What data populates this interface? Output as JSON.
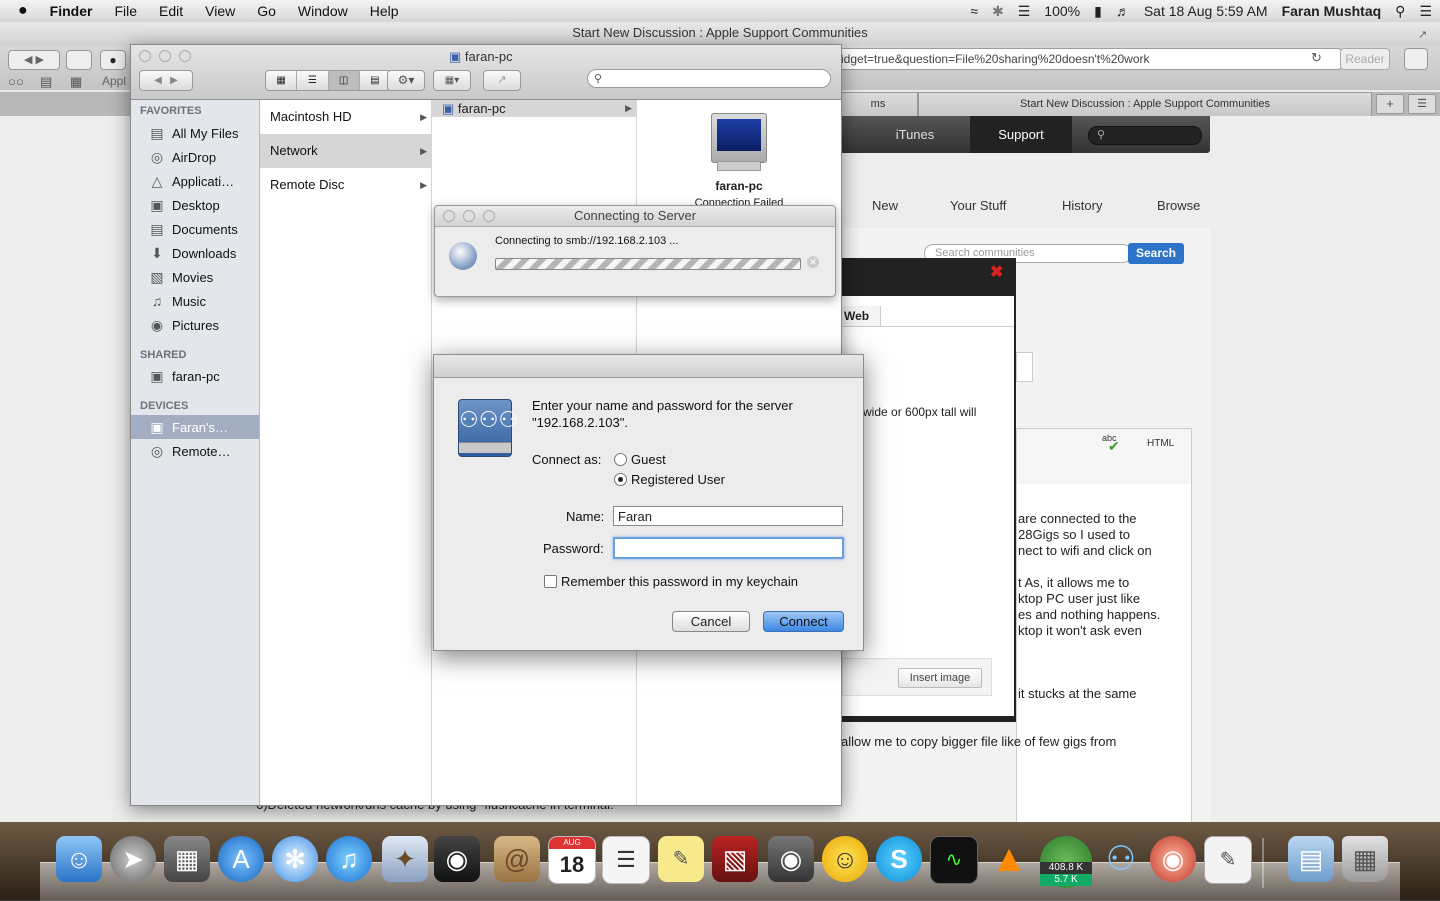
{
  "menubar": {
    "apple": "",
    "app": "Finder",
    "items": [
      "File",
      "Edit",
      "View",
      "Go",
      "Window",
      "Help"
    ],
    "battery": "100%",
    "datetime": "Sat 18 Aug  5:59 AM",
    "user": "Faran Mushtaq"
  },
  "safari": {
    "title": "Start New Discussion : Apple Support Communities",
    "address": "idget=true&question=File%20sharing%20doesn't%20work",
    "reader": "Reader",
    "bookmark_fragment": "Appl",
    "tab_left": "ms",
    "tab_right": "Start New Discussion : Apple Support Communities",
    "nav": {
      "itunes": "iTunes",
      "support": "Support"
    },
    "subnav": [
      "New",
      "Your Stuff",
      "History",
      "Browse"
    ],
    "search_placeholder": "Search communities",
    "search_button": "Search",
    "editor_tab": "Web",
    "html_label": "HTML",
    "spell_label": "abc",
    "insert_image": "Insert image",
    "body_lines": [
      "wide or 600px tall will",
      "are connected to the",
      "28Gigs so I used to",
      "nect to wifi and click on",
      "t As, it allows me to",
      "ktop PC user just like",
      "es and nothing happens.",
      "ktop it won't ask even",
      "it stucks at the same",
      "allow me to copy bigger file like of few gigs from",
      "6)Deleted network/dns cache by using -flushcache in terminal."
    ]
  },
  "finder": {
    "title": "faran-pc",
    "sidebar": {
      "favorites_label": "FAVORITES",
      "favorites": [
        "All My Files",
        "AirDrop",
        "Applicati…",
        "Desktop",
        "Documents",
        "Downloads",
        "Movies",
        "Music",
        "Pictures"
      ],
      "shared_label": "SHARED",
      "shared": [
        "faran-pc"
      ],
      "devices_label": "DEVICES",
      "devices": [
        "Faran's…",
        "Remote…"
      ]
    },
    "col1": [
      "Macintosh HD",
      "Network",
      "Remote Disc"
    ],
    "col2": [
      "faran-pc"
    ],
    "preview_name": "faran-pc",
    "preview_status": "Connection Failed"
  },
  "connecting": {
    "title": "Connecting to Server",
    "message": "Connecting to smb://192.168.2.103 ..."
  },
  "auth": {
    "prompt_line1": "Enter your name and password for the server",
    "prompt_line2": "\"192.168.2.103\".",
    "connect_as_label": "Connect as:",
    "guest_label": "Guest",
    "registered_label": "Registered User",
    "selected": "Registered User",
    "name_label": "Name:",
    "name_value": "Faran",
    "password_label": "Password:",
    "password_value": "",
    "remember_label": "Remember this password in my keychain",
    "cancel": "Cancel",
    "connect": "Connect"
  },
  "dock": {
    "calendar_month": "AUG",
    "calendar_day": "18",
    "network_up": "408.8 K",
    "network_down": "5.7 K"
  }
}
